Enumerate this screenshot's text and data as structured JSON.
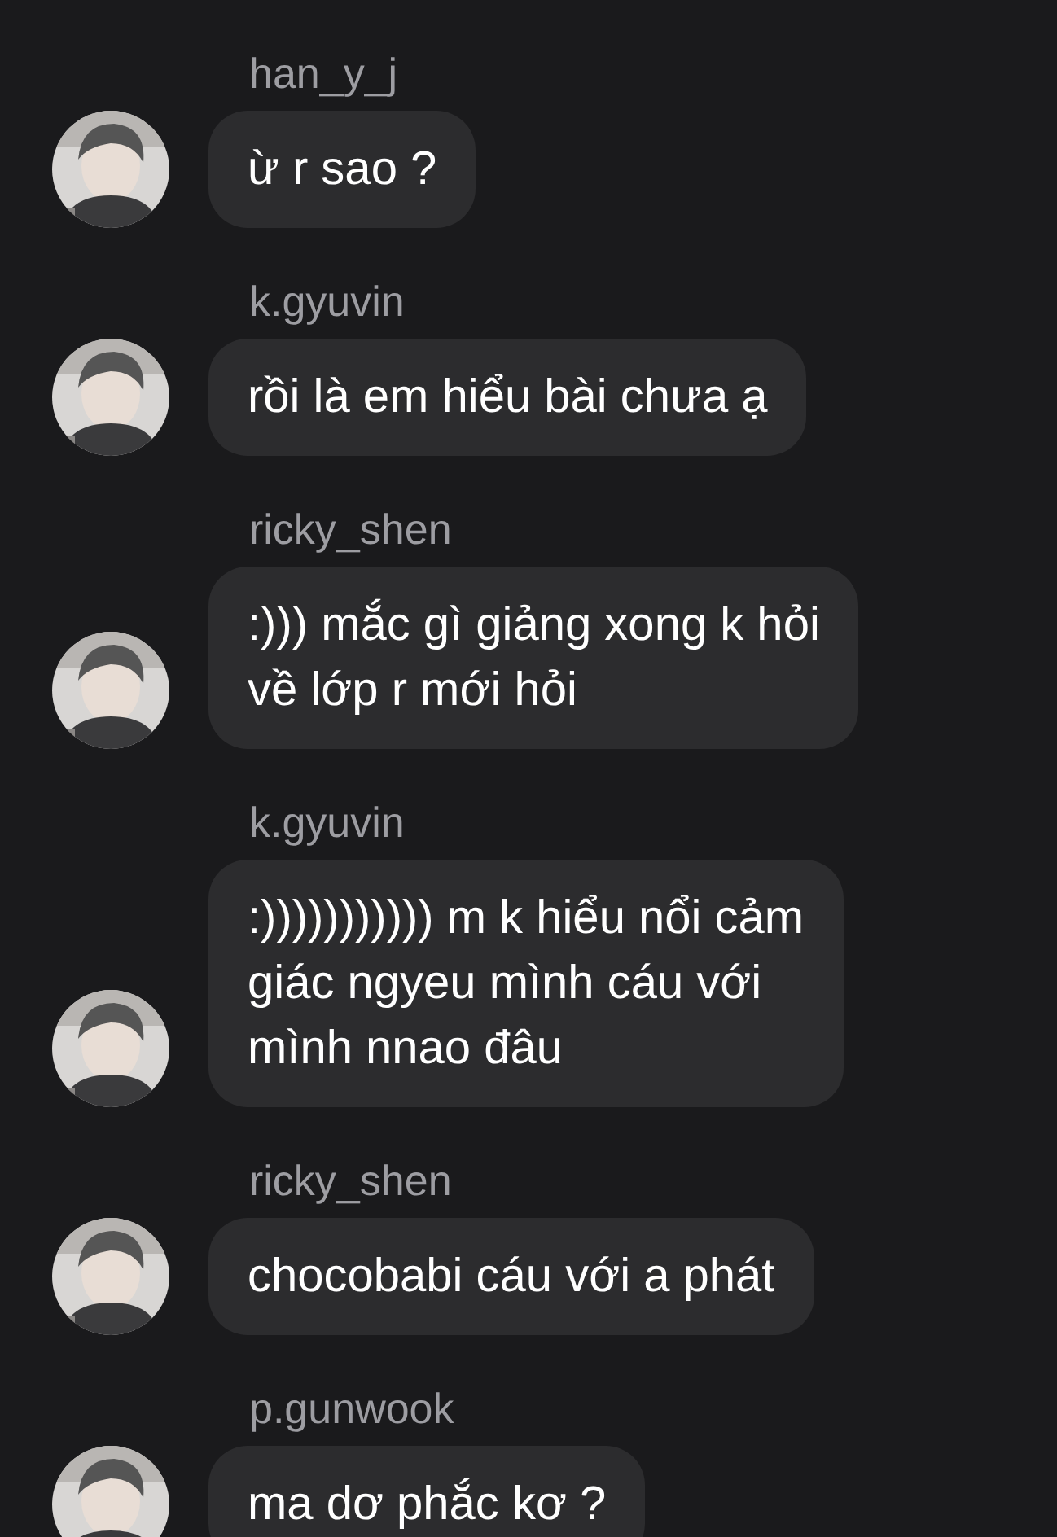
{
  "messages": [
    {
      "sender": "han_y_j",
      "text": "ừ r sao ?"
    },
    {
      "sender": "k.gyuvin",
      "text": "rồi là em hiểu bài chưa ạ"
    },
    {
      "sender": "ricky_shen",
      "text": ":))) mắc gì giảng xong k hỏi\nvề lớp r mới hỏi"
    },
    {
      "sender": "k.gyuvin",
      "text": ":))))))))))) m k hiểu nổi cảm\ngiác ngyeu mình cáu với\nmình nnao đâu"
    },
    {
      "sender": "ricky_shen",
      "text": "chocobabi cáu với a phát"
    },
    {
      "sender": "p.gunwook",
      "text": "ma dơ phắc kơ ?"
    }
  ]
}
